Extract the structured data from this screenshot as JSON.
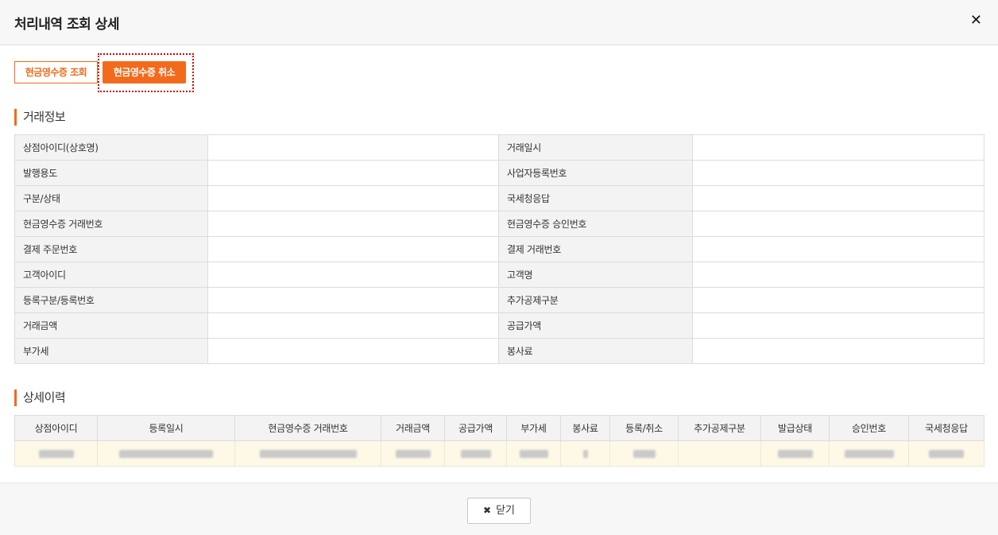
{
  "header": {
    "title": "처리내역 조회 상세",
    "close_glyph": "✕"
  },
  "actions": {
    "inquiry_label": "현금영수증 조회",
    "cancel_label": "현금영수증 취소"
  },
  "transaction_info": {
    "title": "거래정보",
    "rows": [
      [
        "상점아이디(상호명)",
        "거래일시"
      ],
      [
        "발행용도",
        "사업자등록번호"
      ],
      [
        "구분/상태",
        "국세청응답"
      ],
      [
        "현금영수증 거래번호",
        "현금영수증 승인번호"
      ],
      [
        "결제 주문번호",
        "결제 거래번호"
      ],
      [
        "고객아이디",
        "고객명"
      ],
      [
        "등록구분/등록번호",
        "추가공제구분"
      ],
      [
        "거래금액",
        "공급가액"
      ],
      [
        "부가세",
        "봉사료"
      ]
    ]
  },
  "history": {
    "title": "상세이력",
    "columns": [
      "상점아이디",
      "등록일시",
      "현금영수증 거래번호",
      "거래금액",
      "공급가액",
      "부가세",
      "봉사료",
      "등록/취소",
      "추가공제구분",
      "발급상태",
      "승인번호",
      "국세청응답"
    ]
  },
  "footer": {
    "close_label": "닫기",
    "close_icon": "x-icon"
  },
  "colors": {
    "accent": "#f26a1b",
    "focus_outline": "#d10000",
    "label_bg": "#f3f3f3",
    "row_highlight": "#fdf9e6"
  }
}
